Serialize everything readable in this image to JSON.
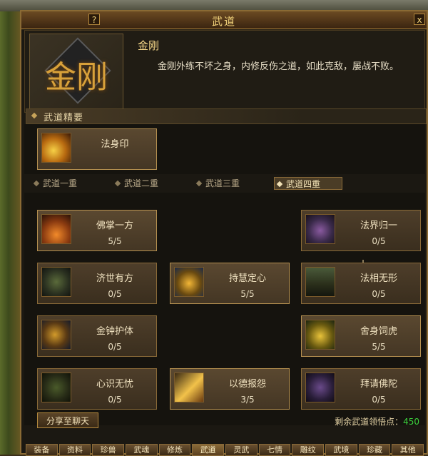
{
  "window": {
    "title": "武道",
    "help": "?",
    "close": "x"
  },
  "header": {
    "emblem_glyph": "金刚",
    "name": "金刚",
    "description": "金刚外练不坏之身，内修反伤之道，如此克敌，屡战不败。"
  },
  "essence": {
    "heading": "武道精要",
    "skill": {
      "name": "法身印",
      "icon": "sun-swirl-icon"
    }
  },
  "tabs": [
    {
      "label": "武道一重",
      "active": false
    },
    {
      "label": "武道二重",
      "active": false
    },
    {
      "label": "武道三重",
      "active": false
    },
    {
      "label": "武道四重",
      "active": true
    }
  ],
  "skills": [
    {
      "name": "佛掌一方",
      "level": "5/5",
      "icon": "palm-strike-icon",
      "active": true
    },
    {
      "name": "法界归一",
      "level": "0/5",
      "icon": "ring-sigil-icon",
      "active": false
    },
    {
      "name": "济世有方",
      "level": "0/5",
      "icon": "swastika-icon",
      "active": false
    },
    {
      "name": "持慧定心",
      "level": "5/5",
      "icon": "meditation-icon",
      "active": true
    },
    {
      "name": "法相无形",
      "level": "0/5",
      "icon": "temple-icon",
      "active": false
    },
    {
      "name": "金钟护体",
      "level": "0/5",
      "icon": "golden-bell-icon",
      "active": false
    },
    {
      "name": "舍身饲虎",
      "level": "5/5",
      "icon": "tiger-icon",
      "active": true
    },
    {
      "name": "心识无忧",
      "level": "0/5",
      "icon": "calm-mind-icon",
      "active": false
    },
    {
      "name": "以德报怨",
      "level": "3/5",
      "icon": "virtue-icon",
      "active": true
    },
    {
      "name": "拜请佛陀",
      "level": "0/5",
      "icon": "buddha-icon",
      "active": false
    }
  ],
  "footer": {
    "share_label": "分享至聊天",
    "points_label": "剩余武道领悟点：",
    "points_value": "450"
  },
  "bottom_tabs": [
    "装备",
    "资料",
    "珍兽",
    "武魂",
    "修炼",
    "武道",
    "灵武",
    "七情",
    "雕纹",
    "武境",
    "珍藏",
    "其他"
  ],
  "bottom_active": "武道",
  "colors": {
    "accent": "#f2d27a",
    "points": "#3cd23c",
    "frame": "#8a6a34"
  }
}
